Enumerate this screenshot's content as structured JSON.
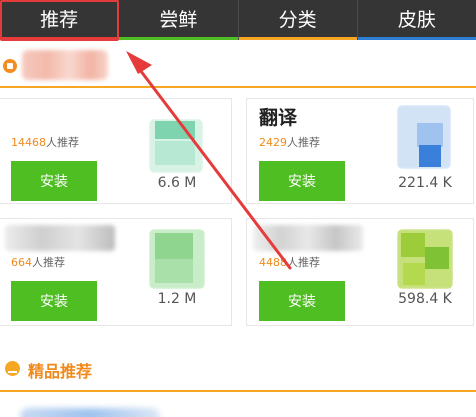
{
  "tabs": [
    {
      "label": "推荐",
      "stripe": "#e63b3b"
    },
    {
      "label": "尝鲜",
      "stripe": "#4fbe22"
    },
    {
      "label": "分类",
      "stripe": "#f5a623"
    },
    {
      "label": "皮肤",
      "stripe": "#2f7fd6"
    }
  ],
  "apps": [
    {
      "title": "",
      "rec_count": "14468",
      "rec_suffix": "人推荐",
      "install": "安装",
      "size": "6.6 M"
    },
    {
      "title": "翻译",
      "rec_count": "2429",
      "rec_suffix": "人推荐",
      "install": "安装",
      "size": "221.4 K"
    },
    {
      "title": "",
      "rec_count": "664",
      "rec_suffix": "人推荐",
      "install": "安装",
      "size": "1.2 M"
    },
    {
      "title": "",
      "rec_count": "4488",
      "rec_suffix": "人推荐",
      "install": "安装",
      "size": "598.4 K"
    }
  ],
  "section": {
    "title": "精品推荐"
  },
  "colors": {
    "accent_orange": "#f5a623",
    "install_green": "#4fbe22",
    "annotation_red": "#e63b3b",
    "tabbar_bg": "#353535"
  },
  "icons": {
    "header_badge": "thumbs-up-badge-icon",
    "section": "crown-icon"
  }
}
